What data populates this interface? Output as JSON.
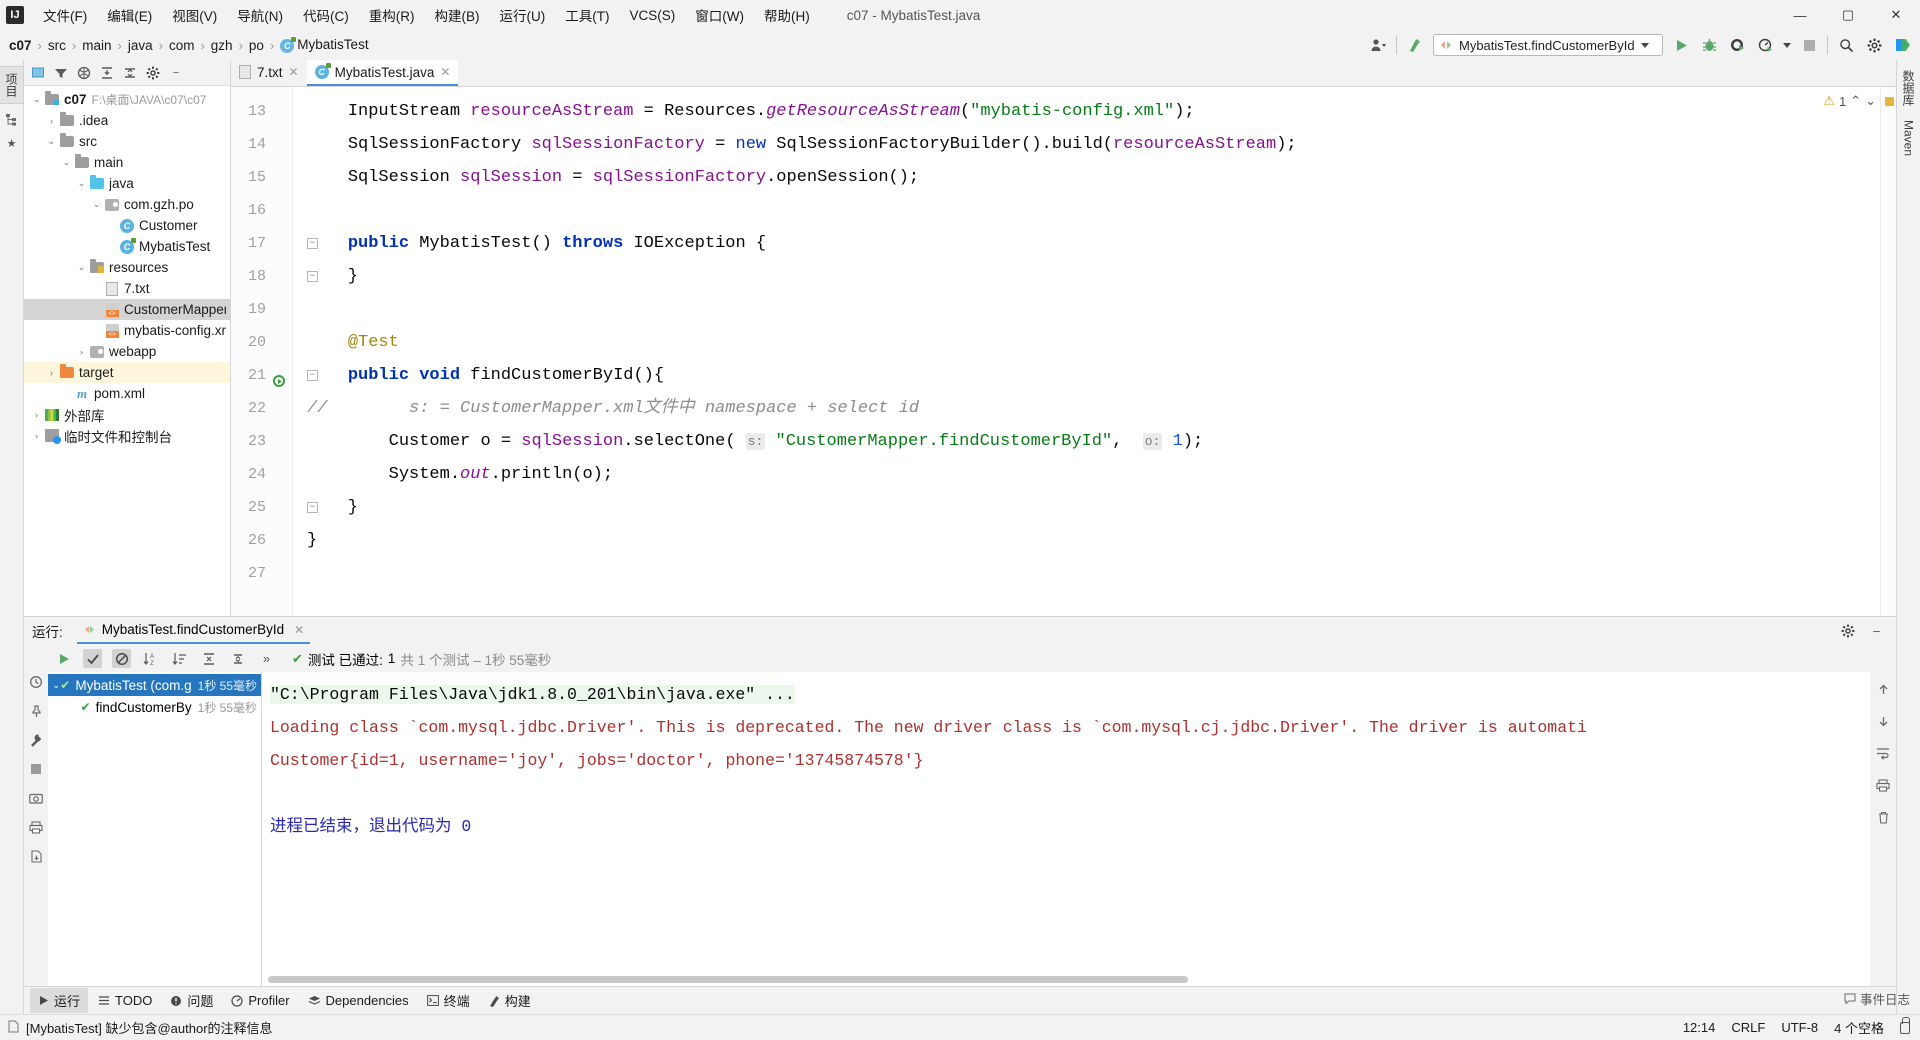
{
  "titlebar": {
    "logo": "IJ",
    "menus": [
      "文件(F)",
      "编辑(E)",
      "视图(V)",
      "导航(N)",
      "代码(C)",
      "重构(R)",
      "构建(B)",
      "运行(U)",
      "工具(T)",
      "VCS(S)",
      "窗口(W)",
      "帮助(H)"
    ],
    "window_title": "c07 - MybatisTest.java",
    "minimize": "—",
    "maximize": "▢",
    "close": "✕"
  },
  "navbar": {
    "breadcrumbs": [
      "c07",
      "src",
      "main",
      "java",
      "com",
      "gzh",
      "po",
      "MybatisTest"
    ],
    "separator": "›",
    "run_config": "MybatisTest.findCustomerById",
    "icons": [
      "user-settings-icon",
      "update-project-icon",
      "run-icon",
      "debug-icon",
      "run-coverage-icon",
      "profile-icon",
      "stop-icon",
      "search-everywhere-icon",
      "settings-icon",
      "idea-icon"
    ]
  },
  "left_rail": {
    "tabs": [
      "项目"
    ],
    "icons": [
      "structure-icon",
      "favorites-icon"
    ]
  },
  "right_rail": {
    "tabs": [
      "数据库",
      "Maven"
    ]
  },
  "project": {
    "toolbar_icons": [
      "select-opened-file-icon",
      "filter-icon",
      "scope-icon",
      "expand-all-icon",
      "collapse-all-icon",
      "settings-icon",
      "hide-icon"
    ],
    "tree": [
      {
        "indent": 0,
        "arrow": "▾",
        "icon": "module-folder-icon",
        "label": "c07",
        "bold": true,
        "path": "F:\\桌面\\JAVA\\c07\\c07",
        "state": "normal"
      },
      {
        "indent": 1,
        "arrow": "›",
        "icon": "folder-icon",
        "label": ".idea",
        "bold": false,
        "path": "",
        "state": "normal"
      },
      {
        "indent": 1,
        "arrow": "▾",
        "icon": "folder-icon",
        "label": "src",
        "bold": false,
        "path": "",
        "state": "normal"
      },
      {
        "indent": 2,
        "arrow": "▾",
        "icon": "folder-icon",
        "label": "main",
        "bold": false,
        "path": "",
        "state": "normal"
      },
      {
        "indent": 3,
        "arrow": "▾",
        "icon": "source-folder-icon",
        "label": "java",
        "bold": false,
        "path": "",
        "state": "normal"
      },
      {
        "indent": 4,
        "arrow": "▾",
        "icon": "package-icon",
        "label": "com.gzh.po",
        "bold": false,
        "path": "",
        "state": "normal"
      },
      {
        "indent": 5,
        "arrow": "",
        "icon": "java-class-icon",
        "label": "Customer",
        "bold": false,
        "path": "",
        "state": "normal"
      },
      {
        "indent": 5,
        "arrow": "",
        "icon": "java-test-class-icon",
        "label": "MybatisTest",
        "bold": false,
        "path": "",
        "state": "normal"
      },
      {
        "indent": 3,
        "arrow": "▾",
        "icon": "resources-folder-icon",
        "label": "resources",
        "bold": false,
        "path": "",
        "state": "normal"
      },
      {
        "indent": 4,
        "arrow": "",
        "icon": "text-file-icon",
        "label": "7.txt",
        "bold": false,
        "path": "",
        "state": "normal"
      },
      {
        "indent": 4,
        "arrow": "",
        "icon": "xml-file-icon",
        "label": "CustomerMapper.xml",
        "bold": false,
        "path": "",
        "state": "selected"
      },
      {
        "indent": 4,
        "arrow": "",
        "icon": "xml-file-icon",
        "label": "mybatis-config.xml",
        "bold": false,
        "path": "",
        "state": "normal"
      },
      {
        "indent": 3,
        "arrow": "›",
        "icon": "webapp-icon",
        "label": "webapp",
        "bold": false,
        "path": "",
        "state": "normal"
      },
      {
        "indent": 1,
        "arrow": "›",
        "icon": "target-folder-icon",
        "label": "target",
        "bold": false,
        "path": "",
        "state": "highlight"
      },
      {
        "indent": 2,
        "arrow": "",
        "icon": "maven-file-icon",
        "label": "pom.xml",
        "bold": false,
        "path": "",
        "state": "normal"
      },
      {
        "indent": 0,
        "arrow": "›",
        "icon": "external-libraries-icon",
        "label": "外部库",
        "bold": false,
        "path": "",
        "state": "normal"
      },
      {
        "indent": 0,
        "arrow": "›",
        "icon": "scratches-icon",
        "label": "临时文件和控制台",
        "bold": false,
        "path": "",
        "state": "normal"
      }
    ]
  },
  "editor": {
    "tabs": [
      {
        "label": "7.txt",
        "icon": "text-file-icon",
        "active": false
      },
      {
        "label": "MybatisTest.java",
        "icon": "java-test-class-icon",
        "active": true
      }
    ],
    "close_glyph": "✕",
    "inspection": {
      "warning_count": "1",
      "up_glyph": "⌃",
      "down_glyph": "⌄"
    },
    "lines": [
      {
        "no": "13",
        "fold": "",
        "runmark": false,
        "segments": [
          {
            "t": "    ",
            "c": "plain"
          },
          {
            "t": "InputStream ",
            "c": "plain"
          },
          {
            "t": "resourceAsStream",
            "c": "var"
          },
          {
            "t": " = ",
            "c": "plain"
          },
          {
            "t": "Resources.",
            "c": "plain"
          },
          {
            "t": "getResourceAsStream",
            "c": "fld"
          },
          {
            "t": "(",
            "c": "plain"
          },
          {
            "t": "\"mybatis-config.xml\"",
            "c": "str"
          },
          {
            "t": ");",
            "c": "plain"
          }
        ]
      },
      {
        "no": "14",
        "fold": "",
        "runmark": false,
        "segments": [
          {
            "t": "    ",
            "c": "plain"
          },
          {
            "t": "SqlSessionFactory ",
            "c": "plain"
          },
          {
            "t": "sqlSessionFactory",
            "c": "var"
          },
          {
            "t": " = ",
            "c": "plain"
          },
          {
            "t": "new",
            "c": "kf"
          },
          {
            "t": " SqlSessionFactoryBuilder().build(",
            "c": "plain"
          },
          {
            "t": "resourceAsStream",
            "c": "var"
          },
          {
            "t": ");",
            "c": "plain"
          }
        ]
      },
      {
        "no": "15",
        "fold": "",
        "runmark": false,
        "segments": [
          {
            "t": "    ",
            "c": "plain"
          },
          {
            "t": "SqlSession ",
            "c": "plain"
          },
          {
            "t": "sqlSession",
            "c": "var"
          },
          {
            "t": " = ",
            "c": "plain"
          },
          {
            "t": "sqlSessionFactory",
            "c": "var"
          },
          {
            "t": ".openSession();",
            "c": "plain"
          }
        ]
      },
      {
        "no": "16",
        "fold": "",
        "runmark": false,
        "segments": []
      },
      {
        "no": "17",
        "fold": "−",
        "runmark": false,
        "segments": [
          {
            "t": "    ",
            "c": "plain"
          },
          {
            "t": "public",
            "c": "k"
          },
          {
            "t": " MybatisTest() ",
            "c": "plain"
          },
          {
            "t": "throws",
            "c": "k"
          },
          {
            "t": " IOException {",
            "c": "plain"
          }
        ]
      },
      {
        "no": "18",
        "fold": "−",
        "runmark": false,
        "segments": [
          {
            "t": "    }",
            "c": "plain"
          }
        ]
      },
      {
        "no": "19",
        "fold": "",
        "runmark": false,
        "segments": []
      },
      {
        "no": "20",
        "fold": "",
        "runmark": false,
        "segments": [
          {
            "t": "    ",
            "c": "plain"
          },
          {
            "t": "@Test",
            "c": "anno"
          }
        ]
      },
      {
        "no": "21",
        "fold": "−",
        "runmark": true,
        "segments": [
          {
            "t": "    ",
            "c": "plain"
          },
          {
            "t": "public",
            "c": "k"
          },
          {
            "t": " ",
            "c": "plain"
          },
          {
            "t": "void",
            "c": "k"
          },
          {
            "t": " findCustomerById(){",
            "c": "plain"
          }
        ]
      },
      {
        "no": "22",
        "fold": "",
        "runmark": false,
        "segments": [
          {
            "t": "//        s: = CustomerMapper.xml文件中 namespace + select id",
            "c": "cmt"
          }
        ]
      },
      {
        "no": "23",
        "fold": "",
        "runmark": false,
        "segments": [
          {
            "t": "        ",
            "c": "plain"
          },
          {
            "t": "Customer ",
            "c": "plain"
          },
          {
            "t": "o",
            "c": "plain"
          },
          {
            "t": " = ",
            "c": "plain"
          },
          {
            "t": "sqlSession",
            "c": "var"
          },
          {
            "t": ".selectOne( ",
            "c": "plain"
          },
          {
            "t": "s:",
            "c": "hint"
          },
          {
            "t": " ",
            "c": "plain"
          },
          {
            "t": "\"CustomerMapper.findCustomerById\"",
            "c": "str"
          },
          {
            "t": ",  ",
            "c": "plain"
          },
          {
            "t": "o:",
            "c": "hint"
          },
          {
            "t": " ",
            "c": "plain"
          },
          {
            "t": "1",
            "c": "num"
          },
          {
            "t": ");",
            "c": "plain"
          }
        ]
      },
      {
        "no": "24",
        "fold": "",
        "runmark": false,
        "segments": [
          {
            "t": "        ",
            "c": "plain"
          },
          {
            "t": "System.",
            "c": "plain"
          },
          {
            "t": "out",
            "c": "fld"
          },
          {
            "t": ".println(o);",
            "c": "plain"
          }
        ]
      },
      {
        "no": "25",
        "fold": "−",
        "runmark": false,
        "segments": [
          {
            "t": "    }",
            "c": "plain"
          }
        ]
      },
      {
        "no": "26",
        "fold": "",
        "runmark": false,
        "segments": [
          {
            "t": "}",
            "c": "plain"
          }
        ]
      },
      {
        "no": "27",
        "fold": "",
        "runmark": false,
        "segments": []
      }
    ]
  },
  "run_panel": {
    "label": "运行:",
    "tab_title": "MybatisTest.findCustomerById",
    "close_glyph": "✕",
    "toolbar_icons": [
      "rerun-icon",
      "show-passed-icon",
      "show-ignored-icon",
      "sort-alphabetically-icon",
      "sort-by-duration-icon",
      "expand-all-icon",
      "collapse-all-icon",
      "more-icon"
    ],
    "status_prefix": "测试 已通过:",
    "status_count": "1",
    "status_total": "共 1 个测试 – 1秒 55毫秒",
    "header_icons": [
      "settings-icon",
      "hide-icon"
    ],
    "left_rail_icons": [
      "history-icon",
      "pin-icon",
      "wrench-icon",
      "stop-icon",
      "camera-icon",
      "print-icon",
      "export-icon"
    ],
    "test_tree": [
      {
        "indent": 0,
        "arrow": "▾",
        "label": "MybatisTest (com.g",
        "time": "1秒 55毫秒",
        "selected": true
      },
      {
        "indent": 1,
        "arrow": "",
        "label": "findCustomerBy",
        "time": "1秒 55毫秒",
        "selected": false
      }
    ],
    "console": [
      {
        "text": "\"C:\\Program Files\\Java\\jdk1.8.0_201\\bin\\java.exe\" ...",
        "style": "cmd"
      },
      {
        "text": "Loading class `com.mysql.jdbc.Driver'. This is deprecated. The new driver class is `com.mysql.cj.jdbc.Driver'. The driver is automati",
        "style": "err"
      },
      {
        "text": "Customer{id=1, username='joy', jobs='doctor', phone='13745874578'}",
        "style": "err"
      },
      {
        "text": "",
        "style": "plain"
      },
      {
        "text": "进程已结束，退出代码为 0",
        "style": "blue"
      }
    ],
    "console_rail_icons": [
      "scroll-up-icon",
      "scroll-down-icon",
      "soft-wrap-icon",
      "print-icon",
      "trash-icon"
    ]
  },
  "toolwindows": [
    {
      "label": "运行",
      "icon": "run-icon",
      "active": true
    },
    {
      "label": "TODO",
      "icon": "todo-icon",
      "active": false
    },
    {
      "label": "问题",
      "icon": "problems-icon",
      "active": false
    },
    {
      "label": "Profiler",
      "icon": "profiler-icon",
      "active": false
    },
    {
      "label": "Dependencies",
      "icon": "dependencies-icon",
      "active": false
    },
    {
      "label": "终端",
      "icon": "terminal-icon",
      "active": false
    },
    {
      "label": "构建",
      "icon": "build-icon",
      "active": false
    }
  ],
  "statusbar": {
    "message": "[MybatisTest] 缺少包含@author的注释信息",
    "event_log": "事件日志",
    "position": "12:14",
    "line_sep": "CRLF",
    "encoding": "UTF-8",
    "indent": "4 个空格",
    "lock_icon": "read-only-icon"
  }
}
